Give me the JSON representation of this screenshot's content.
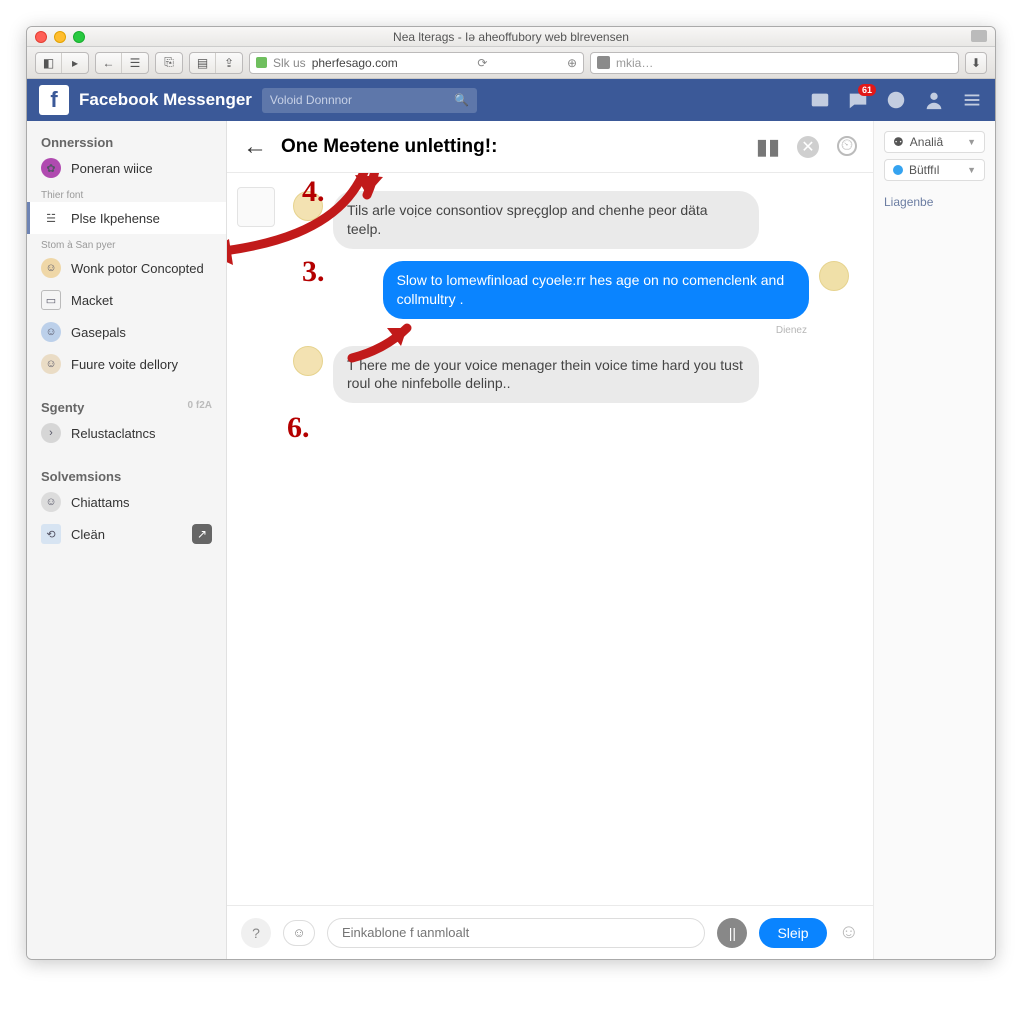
{
  "window": {
    "title": "Nea lterags - Iə aheoffubory web blrevensen"
  },
  "browser": {
    "url_prefix": "Slk us",
    "url": "pherfesago.com",
    "search_placeholder": "mkia…"
  },
  "fb": {
    "app_title": "Facebook Messenger",
    "search_placeholder": "Voloid Donnnor",
    "badge": "61"
  },
  "sidebar": {
    "sect1": "Onnerssion",
    "sect2_label": "Thier font",
    "sect3_label": "Stom à San pyer",
    "sect4": "Sgenty",
    "sect4_badge": "0 f2A",
    "sect5": "Solvemsions",
    "items": {
      "a": "Poneran wiice",
      "b": "Plse Ikpehense",
      "c": "Wonk potor Concopted",
      "d": "Macket",
      "e": "Gasepals",
      "f": "Fuure voite dellory",
      "g": "Relustaclatncs",
      "h": "Chiattams",
      "i": "Cleän"
    }
  },
  "chat": {
    "title": "One Meətene unletting!:",
    "msg1": "Tils arle voịce consontiov spreçglop and chenhe peor däta teelp.",
    "msg2": "Slow to lomewfinload cyoele:rr hes age on no comenclenk and collmultry .",
    "msg2_meta": "Dienez",
    "msg3": "T here me de your voice menager thein voice time hard you tust roul ohe ninfebolle delinp..",
    "composer_placeholder": "Einkablone f ɩanmloalt",
    "send_label": "Sleip"
  },
  "rightcol": {
    "pill1": "Analiâ",
    "pill2": "Bütffıl",
    "link1": "Liagenbe"
  },
  "ann": {
    "a4": "4.",
    "a3": "3.",
    "a6": "6."
  }
}
